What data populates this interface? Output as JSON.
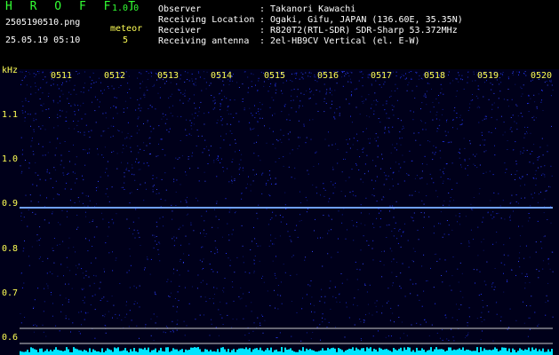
{
  "app": {
    "brand": "H R O F F T",
    "version": "1.0.0"
  },
  "file": {
    "name": "2505190510.png",
    "datetime": "25.05.19 05:10"
  },
  "meteor": {
    "label": "meteor",
    "count": "5"
  },
  "info": [
    {
      "label": "Observer",
      "value": "Takanori Kawachi"
    },
    {
      "label": "Receiving Location",
      "value": "Ogaki, Gifu, JAPAN (136.60E, 35.35N)"
    },
    {
      "label": "Receiver",
      "value": "R820T2(RTL-SDR) SDR-Sharp 53.372MHz"
    },
    {
      "label": "Receiving antenna",
      "value": "2el-HB9CV Vertical (el. E-W)"
    }
  ],
  "axis": {
    "unit": "kHz",
    "y_ticks": [
      "1.1",
      "1.0",
      "0.9",
      "0.8",
      "0.7",
      "0.6"
    ],
    "x_ticks": [
      "0511",
      "0512",
      "0513",
      "0514",
      "0515",
      "0516",
      "0517",
      "0518",
      "0519",
      "0520"
    ]
  },
  "colors": {
    "background": "#00001a",
    "noise": "#2233ff",
    "carrier": "#6fa0ff",
    "label": "#ffff55",
    "header_green": "#33ff33",
    "baseline": "#00e5ff"
  }
}
